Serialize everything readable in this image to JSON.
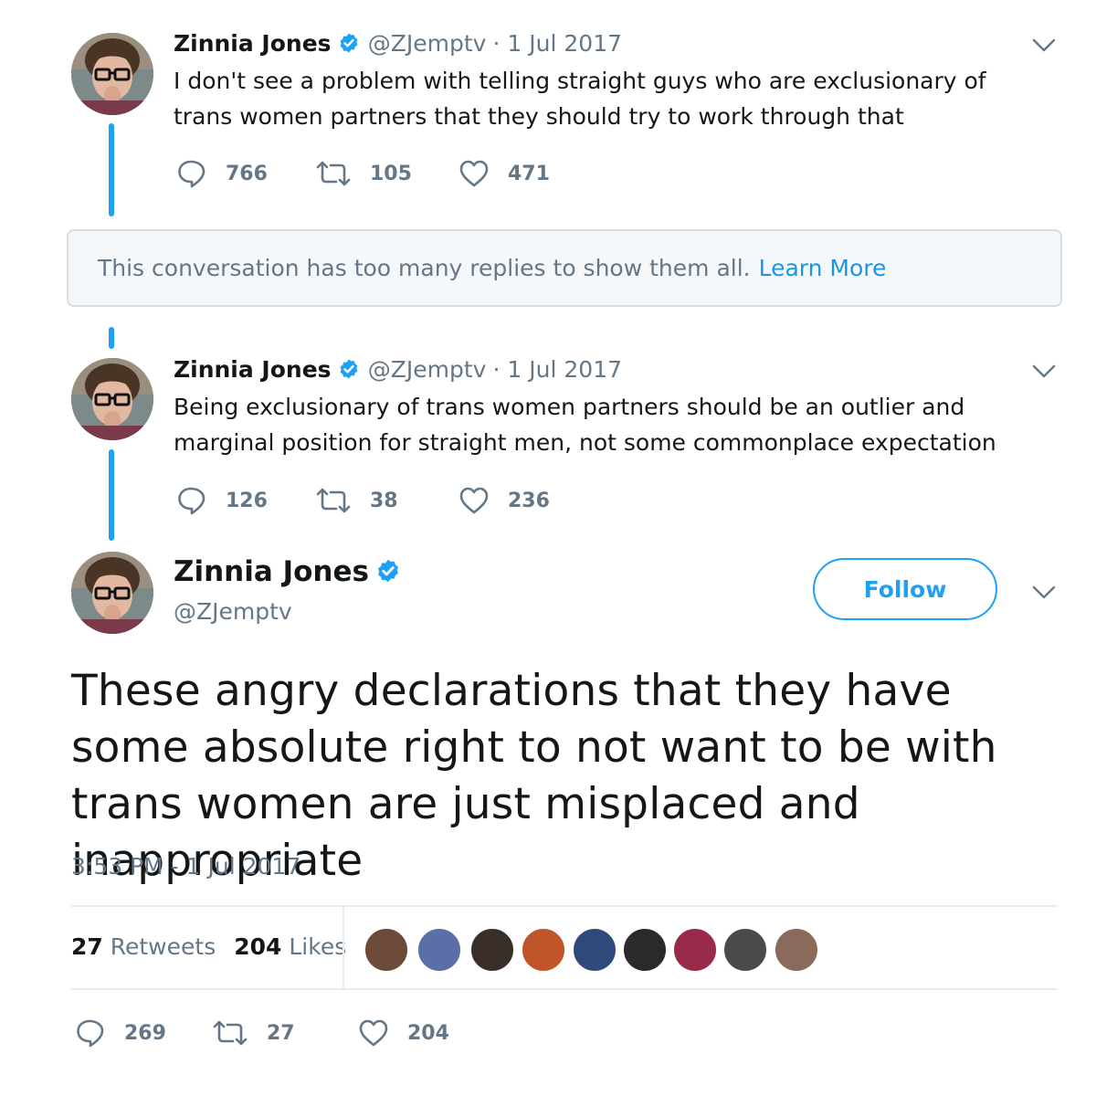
{
  "tweets": [
    {
      "name": "Zinnia Jones",
      "handle": "@ZJemptv",
      "date": "· 1 Jul 2017",
      "text": "I don't see a problem with telling straight guys who are exclusionary of trans women partners that they should try to work through that",
      "replies": "766",
      "retweets": "105",
      "likes": "471"
    },
    {
      "name": "Zinnia Jones",
      "handle": "@ZJemptv",
      "date": "· 1 Jul 2017",
      "text": "Being exclusionary of trans women partners should be an outlier and marginal position for straight men, not some commonplace expectation",
      "replies": "126",
      "retweets": "38",
      "likes": "236"
    }
  ],
  "notice": {
    "text": "This conversation has too many replies to show them all.",
    "link": "Learn More"
  },
  "main_tweet": {
    "name": "Zinnia Jones",
    "handle": "@ZJemptv",
    "follow_label": "Follow",
    "text": "These angry declarations that they have some absolute right to not want to be with trans women are just misplaced and inappropriate",
    "timestamp": "3:53 PM - 1 Jul 2017",
    "retweet_count": "27",
    "retweet_label": "Retweets",
    "like_count": "204",
    "like_label": "Likes",
    "replies": "269",
    "retweets": "27",
    "likes": "204"
  },
  "colors": {
    "accent": "#1da1f2",
    "link": "#1b95e0",
    "muted": "#657786",
    "text": "#14171a"
  },
  "icons": [
    "verified-badge-icon",
    "chevron-down-icon",
    "reply-icon",
    "retweet-icon",
    "like-icon"
  ]
}
